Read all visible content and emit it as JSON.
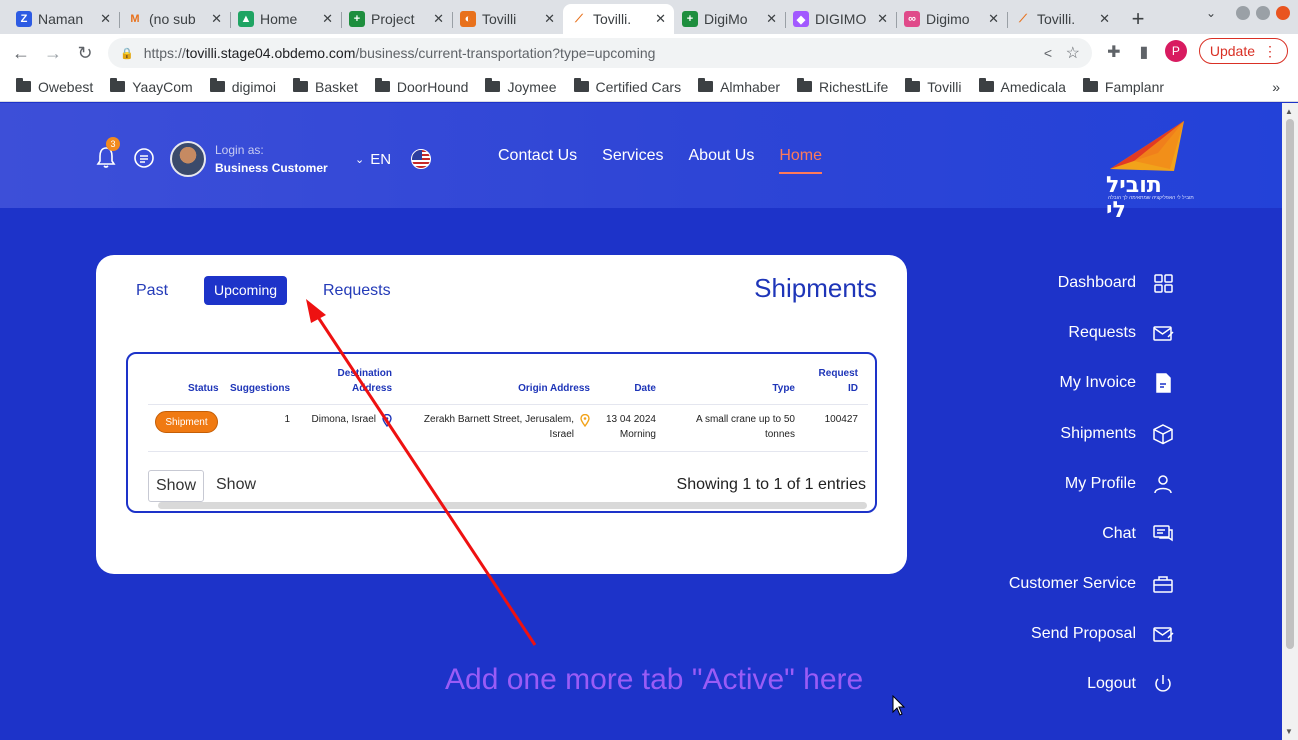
{
  "browser": {
    "tabs": [
      {
        "title": "Naman",
        "fav": "Z",
        "color": "#2d5be3"
      },
      {
        "title": "(no sub",
        "fav": "M",
        "color": "#ffffff"
      },
      {
        "title": "Home",
        "fav": "▲",
        "color": "#1fa463"
      },
      {
        "title": "Project",
        "fav": "+",
        "color": "#1e8e3e"
      },
      {
        "title": "Tovilli",
        "fav": "◐",
        "color": "#e8711c"
      },
      {
        "title": "Tovilli.",
        "fav": "⟋",
        "color": "#ffffff",
        "active": true
      },
      {
        "title": "DigiMo",
        "fav": "+",
        "color": "#1e8e3e"
      },
      {
        "title": "DIGIMO",
        "fav": "◆",
        "color": "#a259ff"
      },
      {
        "title": "Digimo",
        "fav": "∞",
        "color": "#e04a8a"
      },
      {
        "title": "Tovilli.",
        "fav": "⟋",
        "color": "#ffffff"
      }
    ],
    "url_host": "tovilli.stage04.obdemo.com",
    "url_path": "/business/current-transportation?type=upcoming",
    "profile_letter": "P",
    "update_label": "Update",
    "bookmarks": [
      "Owebest",
      "YaayCom",
      "digimoi",
      "Basket",
      "DoorHound",
      "Joymee",
      "Certified Cars",
      "Almhaber",
      "RichestLife",
      "Tovilli",
      "Amedicala",
      "Famplanr"
    ],
    "bookmarks_more": "»"
  },
  "header": {
    "notification_count": "3",
    "login_label": "Login as:",
    "login_role": "Business Customer",
    "language": "EN",
    "nav": [
      "Contact Us",
      "Services",
      "About Us",
      "Home"
    ],
    "active_nav": "Home",
    "brand_name": "תוביל לי",
    "brand_tagline": "תוביל לי האפליקציה שמתאימה לך הובלה"
  },
  "shipments": {
    "title": "Shipments",
    "tabs": {
      "past": "Past",
      "upcoming": "Upcoming",
      "requests": "Requests"
    },
    "active_tab": "Upcoming",
    "columns": {
      "status": "Status",
      "suggestions": "Suggestions",
      "destination_1": "Destination",
      "destination_2": "Address",
      "origin": "Origin Address",
      "date": "Date",
      "type": "Type",
      "request_1": "Request",
      "request_2": "ID"
    },
    "row": {
      "status": "Shipment",
      "suggestions": "1",
      "destination": "Dimona, Israel",
      "origin_1": "Zerakh Barnett Street, Jerusalem,",
      "origin_2": "Israel",
      "date_1": "13 04 2024",
      "date_2": "Morning",
      "type_1": "A small crane up to 50",
      "type_2": "tonnes",
      "request_id": "100427"
    },
    "show_value": "Show",
    "show_label": "Show",
    "entries": "Showing 1 to 1 of 1 entries"
  },
  "sidebar": {
    "items": [
      {
        "label": "Dashboard",
        "icon": "grid-icon"
      },
      {
        "label": "Requests",
        "icon": "mail-edit-icon"
      },
      {
        "label": "My Invoice",
        "icon": "document-icon"
      },
      {
        "label": "Shipments",
        "icon": "box-icon"
      },
      {
        "label": "My Profile",
        "icon": "user-icon"
      },
      {
        "label": "Chat",
        "icon": "chat-icon"
      },
      {
        "label": "Customer Service",
        "icon": "briefcase-icon"
      },
      {
        "label": "Send Proposal",
        "icon": "mail-edit-icon"
      },
      {
        "label": "Logout",
        "icon": "power-icon"
      }
    ]
  },
  "annotation": {
    "text": "Add one more tab \"Active\" here",
    "color": "#9a5cf6",
    "arrow_color": "#ee1111"
  },
  "colors": {
    "page_bg": "#1d33c9",
    "accent": "#ff7a59",
    "status_orange": "#f07a12"
  }
}
